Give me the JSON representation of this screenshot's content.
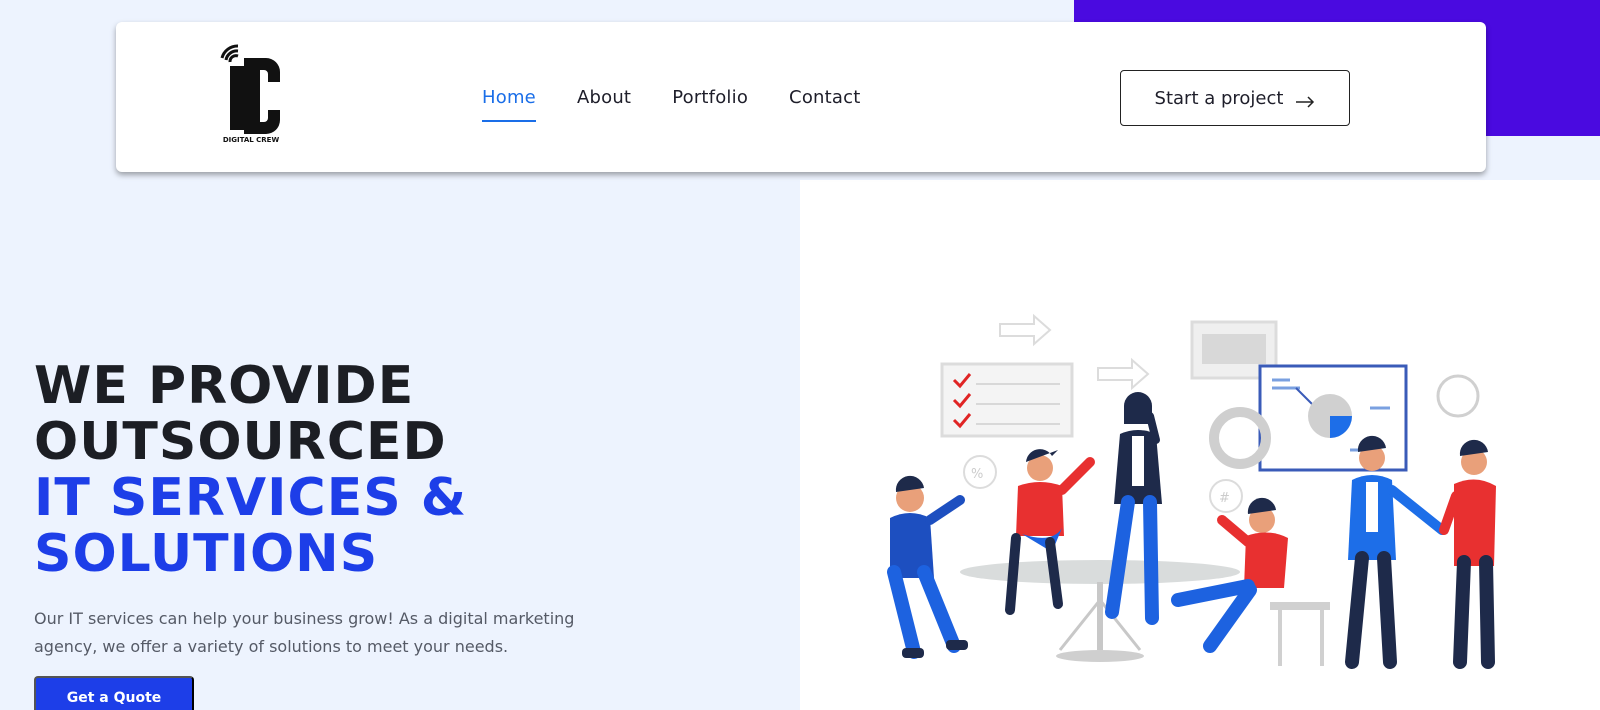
{
  "brand": {
    "logo_letters": "DC",
    "logo_text": "DIGITAL CREW"
  },
  "nav": {
    "items": [
      {
        "label": "Home",
        "active": true
      },
      {
        "label": "About",
        "active": false
      },
      {
        "label": "Portfolio",
        "active": false
      },
      {
        "label": "Contact",
        "active": false
      }
    ],
    "cta_label": "Start a project"
  },
  "hero": {
    "title_line1": "WE PROVIDE",
    "title_line2": "OUTSOURCED",
    "title_line3": "IT SERVICES &",
    "title_line4": "SOLUTIONS",
    "description": "Our IT services can help your business grow! As a digital marketing agency, we offer a variety of solutions to meet your needs.",
    "button_label": "Get a Quote"
  },
  "colors": {
    "accent_blue": "#1d3ee8",
    "nav_active": "#1a6ee8",
    "purple_block": "#4a0ae0",
    "background": "#edf3fe"
  }
}
